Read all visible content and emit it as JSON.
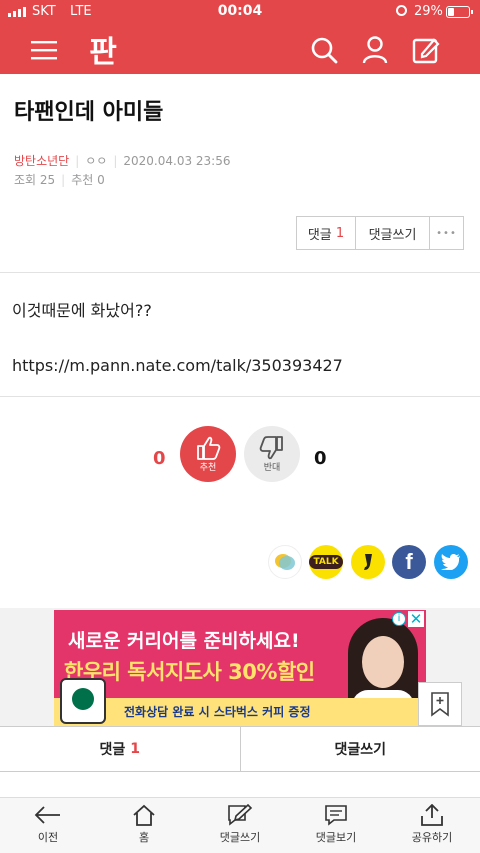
{
  "status_bar": {
    "carrier": "SKT",
    "network": "LTE",
    "time": "00:04",
    "battery_percent": "29%",
    "battery_level": 0.29
  },
  "header": {
    "logo": "판",
    "icons": [
      "menu-icon",
      "search-icon",
      "user-icon",
      "write-icon"
    ]
  },
  "post": {
    "title": "타팬인데 아미들",
    "category": "방탄소년단",
    "author": "ㅇㅇ",
    "datetime": "2020.04.03 23:56",
    "views_label": "조회 25",
    "recommend_label": "추천 0",
    "body_text": "이것때문에 화났어??",
    "body_link": "https://m.pann.nate.com/talk/350393427"
  },
  "actions": {
    "comment_label": "댓글",
    "comment_count": "1",
    "write_comment_label": "댓글쓰기",
    "more_label": "•••"
  },
  "votes": {
    "up_count": "0",
    "up_label": "추천",
    "down_count": "0",
    "down_label": "반대"
  },
  "share": {
    "icons": [
      "kakaostory-icon",
      "kakaotalk-icon",
      "kakaopage-icon",
      "facebook-icon",
      "twitter-icon"
    ],
    "talk_label": "TALK",
    "facebook_label": "f"
  },
  "ad": {
    "line1": "새로운 커리어를 준비하세요!",
    "line2": "한우리 독서지도사 30%할인",
    "line3": "전화상담 완료 시 스타벅스 커피 증정",
    "info_icon": "i",
    "close_icon": "✕"
  },
  "comment_bar": {
    "comment_label": "댓글",
    "comment_count": "1",
    "write_label": "댓글쓰기"
  },
  "bottom_nav": [
    {
      "label": "이전",
      "icon": "back-arrow-icon"
    },
    {
      "label": "홈",
      "icon": "home-icon"
    },
    {
      "label": "댓글쓰기",
      "icon": "write-comment-icon"
    },
    {
      "label": "댓글보기",
      "icon": "view-comment-icon"
    },
    {
      "label": "공유하기",
      "icon": "share-icon"
    }
  ],
  "colors": {
    "brand_red": "#e4474a",
    "ad_pink": "#e4356b",
    "facebook": "#3b5998",
    "twitter": "#1da1f2",
    "kakao_yellow": "#fae100"
  }
}
